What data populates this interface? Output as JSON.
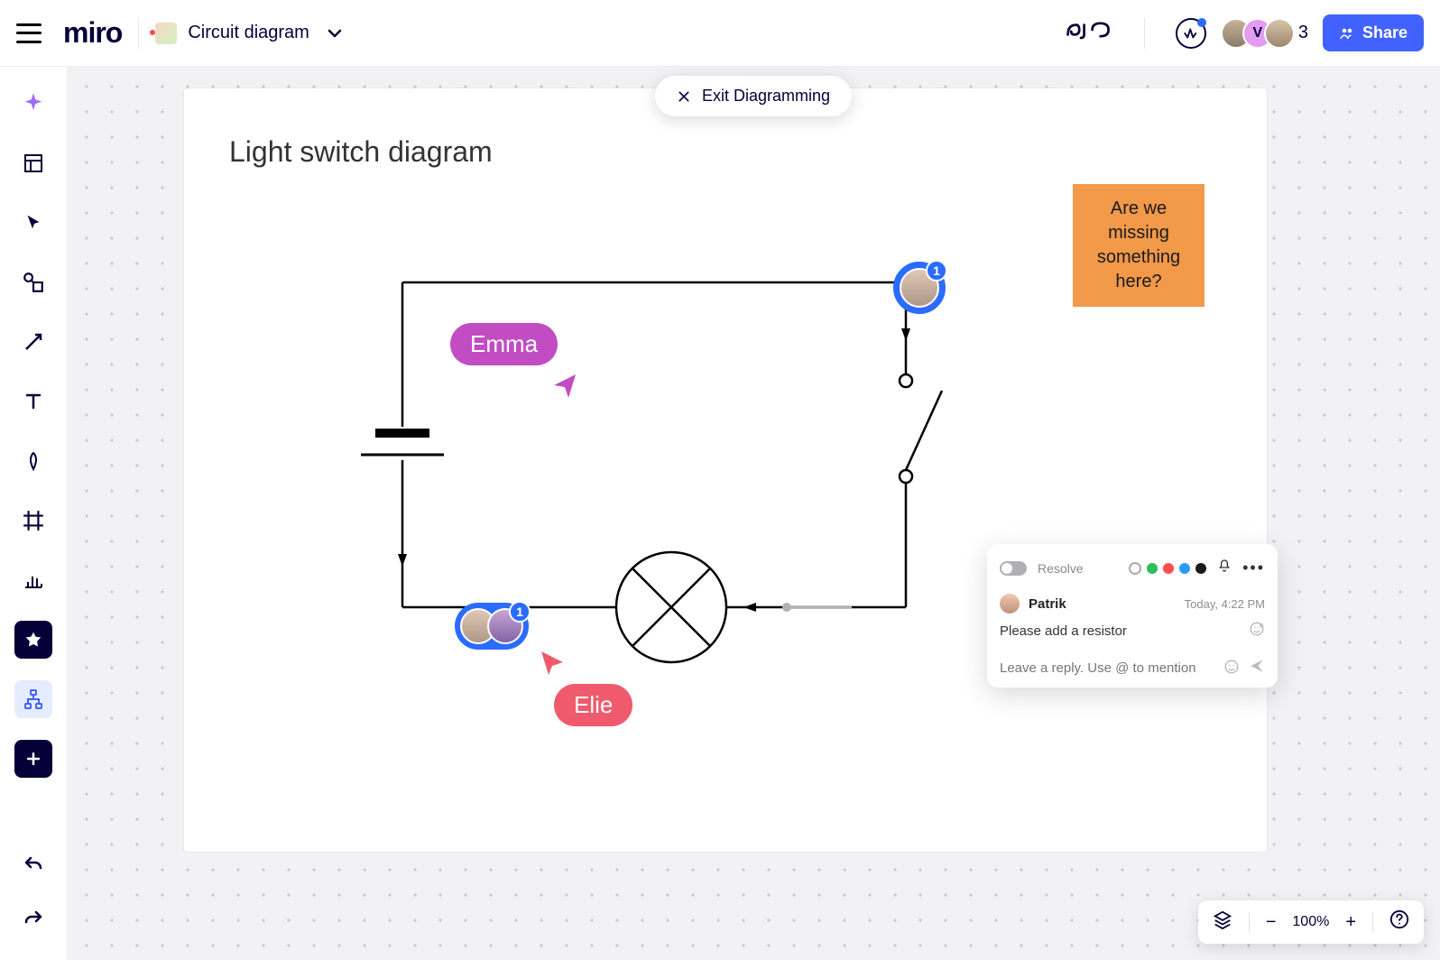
{
  "topbar": {
    "logo": "miro",
    "board_name": "Circuit diagram",
    "share_label": "Share",
    "collaborator_count": "3",
    "avatar_v_letter": "V"
  },
  "canvas": {
    "exit_label": "Exit Diagramming",
    "sheet_title": "Light switch diagram",
    "sticky_note": "Are we missing something here?",
    "cursors": {
      "emma": "Emma",
      "elie": "Elie"
    },
    "comment_badge_1": "1",
    "comment_badge_2": "1"
  },
  "comment_popover": {
    "resolve_label": "Resolve",
    "author": "Patrik",
    "timestamp": "Today, 4:22 PM",
    "message": "Please add a resistor",
    "reply_placeholder": "Leave a reply. Use @ to mention",
    "color_options": [
      "#eee",
      "#2fbf57",
      "#ff4d4d",
      "#2b9cff",
      "#1a1a1a"
    ]
  },
  "zoombar": {
    "zoom_level": "100%"
  },
  "rail_tooltips": {
    "ai": "AI",
    "templates": "Templates",
    "select": "Select",
    "shapes": "Shapes",
    "connector": "Connector",
    "text": "Text",
    "pen": "Pen",
    "frame": "Frame",
    "chart": "Chart",
    "sticky": "Sticky",
    "diagram": "Diagramming",
    "more": "More",
    "undo": "Undo",
    "redo": "Redo"
  }
}
